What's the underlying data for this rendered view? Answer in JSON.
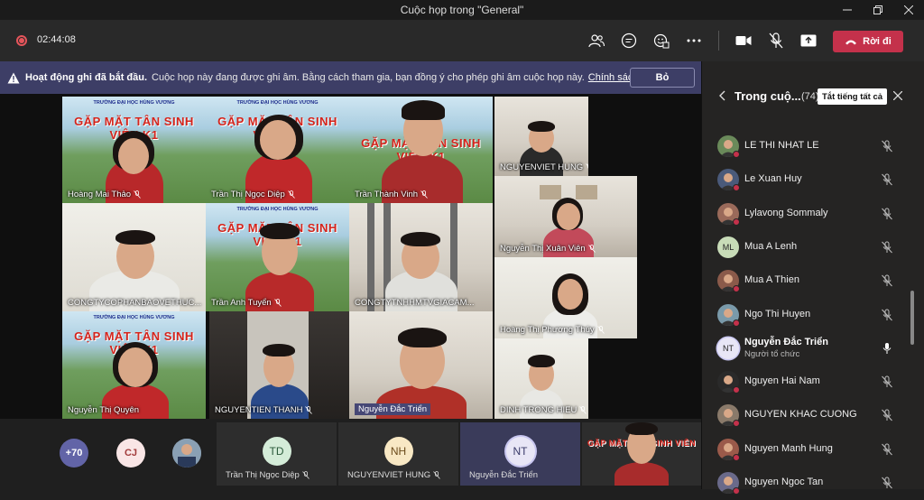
{
  "window": {
    "title": "Cuộc họp trong \"General\""
  },
  "toolbar": {
    "timer": "02:44:08",
    "leave_label": "Rời đi",
    "icons": [
      "people-icon",
      "chat-icon",
      "reactions-icon",
      "more-icon",
      "camera-icon",
      "mic-off-icon",
      "share-icon",
      "phone-icon"
    ]
  },
  "banner": {
    "title": "Hoạt động ghi đã bắt đầu.",
    "message": "Cuộc họp này đang được ghi âm. Bằng cách tham gia, bạn đồng ý cho phép ghi âm cuộc họp này.",
    "link": "Chính sách v...",
    "dismiss_label": "Bỏ"
  },
  "event_banner": {
    "line1": "TRƯỜNG ĐẠI HỌC HÙNG VƯƠNG",
    "main": "GẶP MẶT TÂN SINH VIÊN K1"
  },
  "tiles": [
    {
      "name": "Hoàng Mai Thảo"
    },
    {
      "name": "Trần Thị Ngọc Diệp"
    },
    {
      "name": "Trần Thành Vinh"
    },
    {
      "name": "NGUYENVIET HUNG"
    },
    {
      "name": "CONGTYCOPHANBAOVETHUC..."
    },
    {
      "name": "Trần Anh Tuyển"
    },
    {
      "name": "CONGTYTNHHMTVGIACAM..."
    },
    {
      "name": "Nguyễn Thị Xuân Viên"
    },
    {
      "name": "Nguyễn Thị Quyên"
    },
    {
      "name": "NGUYENTIEN THANH"
    },
    {
      "name": "Nguyễn Đắc Triển"
    },
    {
      "name": "Hoàng Thị Phương Thúy"
    },
    {
      "name": "DINH TRONG HIEU"
    }
  ],
  "bottom": {
    "overflow": "+70",
    "cj": "CJ",
    "mini_tiles": [
      {
        "initials": "TD",
        "name": "Trần Thị Ngọc Diệp"
      },
      {
        "initials": "NH",
        "name": "NGUYENVIET HUNG"
      },
      {
        "initials": "NT",
        "name": "Nguyễn Đắc Triển"
      }
    ]
  },
  "panel": {
    "title": "Trong cuộ...",
    "count": "(74)",
    "mute_all": "Tắt tiếng tất cả",
    "participants": [
      {
        "name": "LE THI NHAT LE",
        "avatar": "photo",
        "color": "#6a8a5a"
      },
      {
        "name": "Le Xuan Huy",
        "avatar": "photo",
        "color": "#4a5a7a"
      },
      {
        "name": "Lylavong Sommaly",
        "avatar": "photo",
        "color": "#9a6a5a"
      },
      {
        "name": "Mua A Lenh",
        "avatar": "ML",
        "color": "#c8dcb8"
      },
      {
        "name": "Mua A Thien",
        "avatar": "photo",
        "color": "#8a5a4a"
      },
      {
        "name": "Ngo Thi Huyen",
        "avatar": "photo",
        "color": "#7a9aaa"
      },
      {
        "name": "Nguyễn Đắc Triển",
        "sub": "Người tổ chức",
        "avatar": "NT",
        "color": "#e8e6f6",
        "mic_on": true
      },
      {
        "name": "Nguyen Hai Nam",
        "avatar": "photo",
        "color": "#2a2a2a"
      },
      {
        "name": "NGUYEN KHAC CUONG",
        "avatar": "photo",
        "color": "#8a7a6a"
      },
      {
        "name": "Nguyen Manh Hung",
        "avatar": "photo",
        "color": "#9a5a4a"
      },
      {
        "name": "Nguyen Ngoc Tan",
        "avatar": "photo",
        "color": "#6a6a8a"
      }
    ]
  },
  "colors": {
    "leave": "#c4314b",
    "banner_bg": "#3d3e66",
    "panel_bg": "#252423"
  }
}
